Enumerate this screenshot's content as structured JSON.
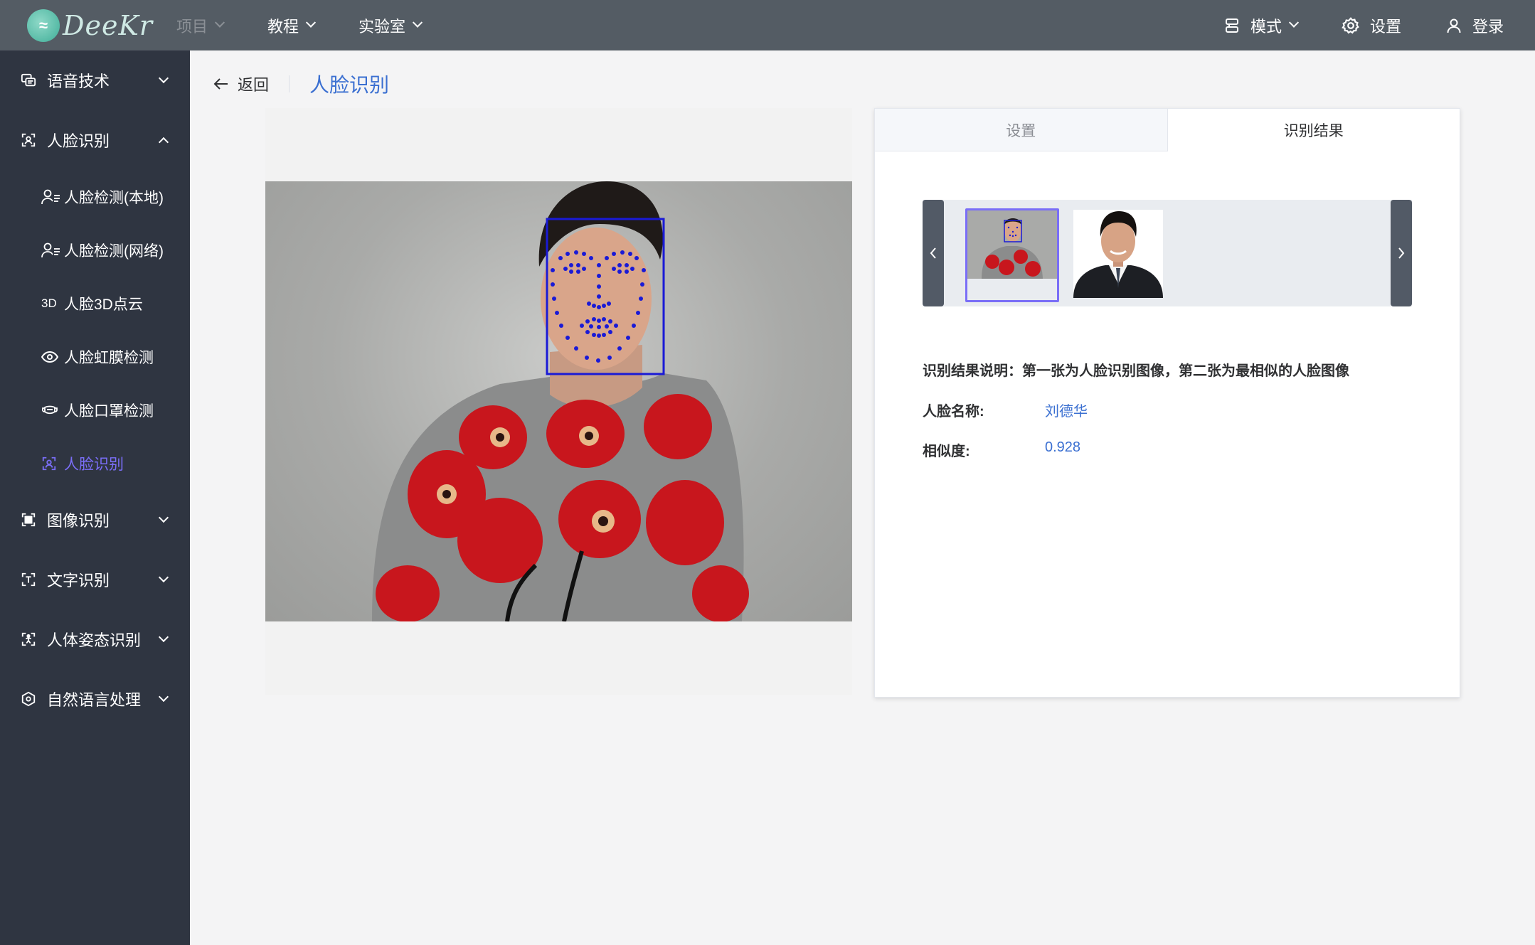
{
  "topbar": {
    "logo_text": "DeeKr",
    "menu": [
      {
        "label": "项目",
        "disabled": true
      },
      {
        "label": "教程",
        "disabled": false
      },
      {
        "label": "实验室",
        "disabled": false
      }
    ],
    "mode_label": "模式",
    "settings_label": "设置",
    "login_label": "登录"
  },
  "sidebar": {
    "groups": [
      {
        "label": "语音技术",
        "icon": "speech-icon",
        "expanded": false
      },
      {
        "label": "人脸识别",
        "icon": "face-icon",
        "expanded": true
      },
      {
        "label": "图像识别",
        "icon": "image-icon",
        "expanded": false
      },
      {
        "label": "文字识别",
        "icon": "text-icon",
        "expanded": false
      },
      {
        "label": "人体姿态识别",
        "icon": "pose-icon",
        "expanded": false
      },
      {
        "label": "自然语言处理",
        "icon": "nlp-icon",
        "expanded": false
      }
    ],
    "face_items": [
      {
        "label": "人脸检测(本地)",
        "icon": "user-list-icon"
      },
      {
        "label": "人脸检测(网络)",
        "icon": "user-list-icon"
      },
      {
        "label": "人脸3D点云",
        "icon": "3d-icon"
      },
      {
        "label": "人脸虹膜检测",
        "icon": "eye-icon"
      },
      {
        "label": "人脸口罩检测",
        "icon": "mask-icon"
      },
      {
        "label": "人脸识别",
        "icon": "face-icon",
        "active": true
      }
    ]
  },
  "breadcrumb": {
    "back_label": "返回",
    "title": "人脸识别"
  },
  "result": {
    "tabs": [
      {
        "label": "设置",
        "active": false
      },
      {
        "label": "识别结果",
        "active": true
      }
    ],
    "description": "识别结果说明：第一张为人脸识别图像，第二张为最相似的人脸图像",
    "name_key": "人脸名称:",
    "name_value": "刘德华",
    "similarity_key": "相似度:",
    "similarity_value": "0.928"
  },
  "colors": {
    "topbar": "#545c64",
    "sidebar": "#2f3541",
    "accent": "#7a6ef7",
    "link": "#3a6fd1",
    "landmarks": "#1a1ad6"
  }
}
